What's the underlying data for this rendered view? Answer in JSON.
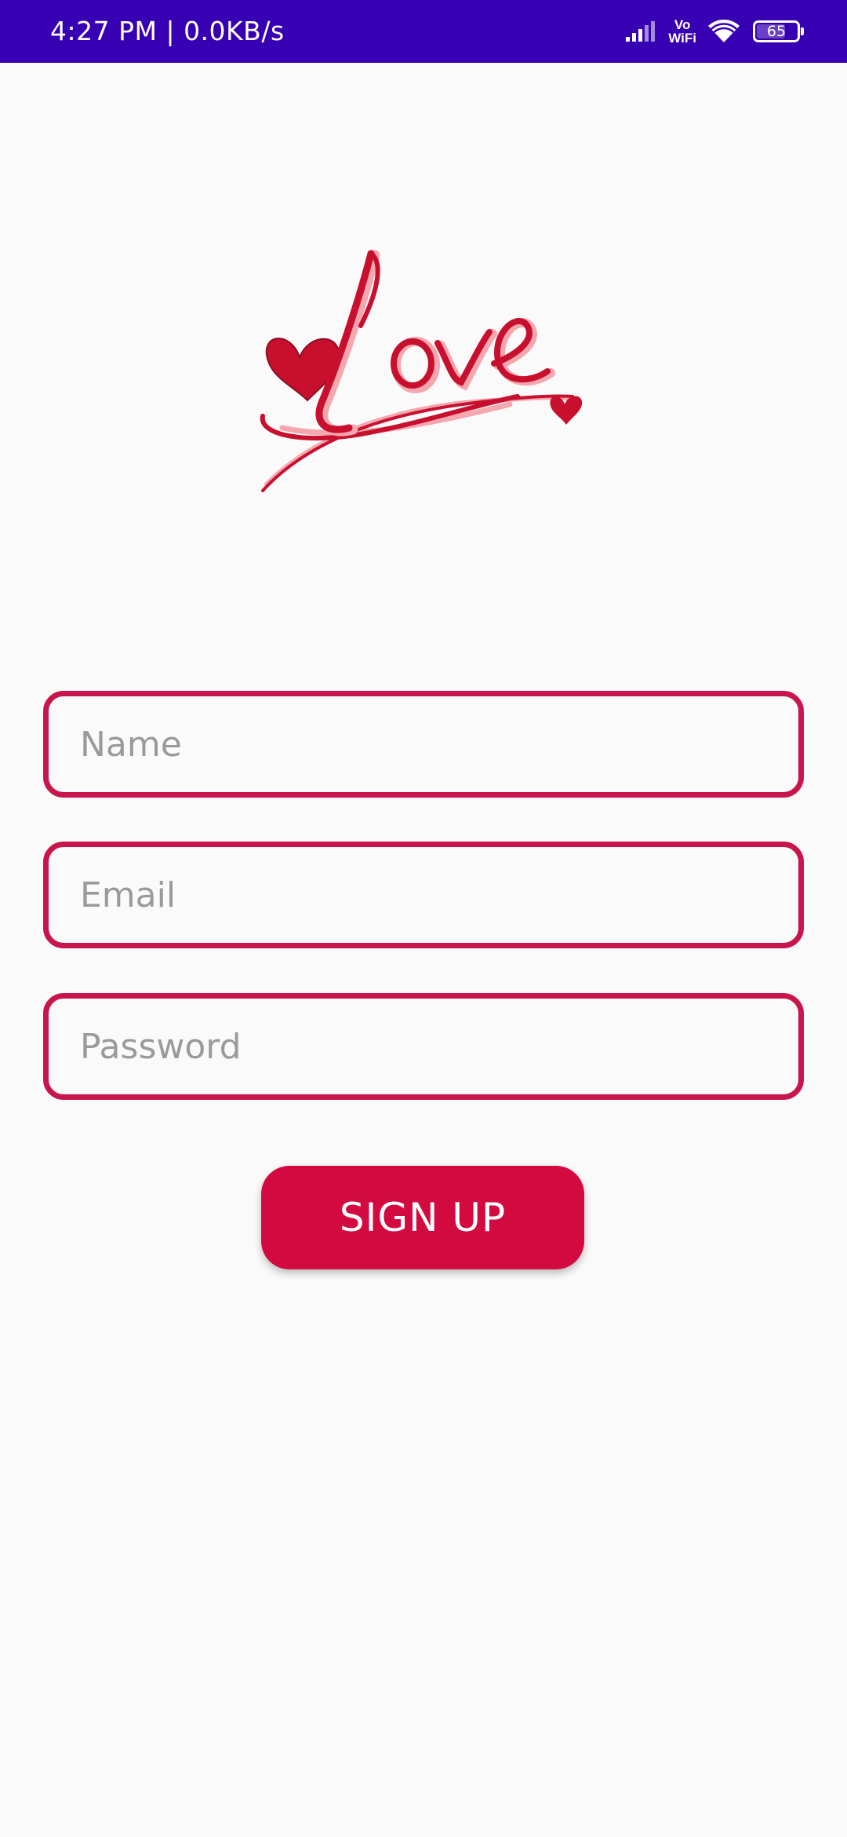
{
  "status_bar": {
    "time_speed": "4:27 PM | 0.0KB/s",
    "vowifi_top": "Vo",
    "vowifi_bottom": "WiFi",
    "battery": "65",
    "background_color": "#3700b3"
  },
  "logo": {
    "text": "Love",
    "icon": "heart-icon",
    "colors": {
      "primary": "#c8102e",
      "secondary": "#f4a7ae"
    }
  },
  "form": {
    "name_placeholder": "Name",
    "email_placeholder": "Email",
    "password_placeholder": "Password",
    "border_color": "#c8154b"
  },
  "signup_button": {
    "label": "SIGN UP",
    "color": "#d20a40"
  }
}
